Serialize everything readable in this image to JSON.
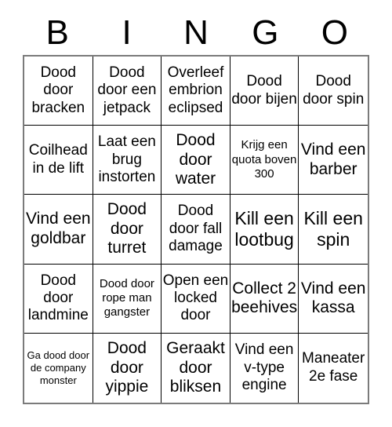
{
  "card": {
    "header_letters": [
      "B",
      "I",
      "N",
      "G",
      "O"
    ],
    "columns": 5,
    "rows": 5,
    "colors": {
      "background": "#ffffff",
      "text": "#000000",
      "cell_border": "#000000",
      "outer_border": "#7b7b7b"
    },
    "cells": [
      {
        "text": "Dood door bracken",
        "size": "md"
      },
      {
        "text": "Dood door een jetpack",
        "size": "md"
      },
      {
        "text": "Overleef embrion eclipsed",
        "size": "md"
      },
      {
        "text": "Dood door bijen",
        "size": "md"
      },
      {
        "text": "Dood door spin",
        "size": "md"
      },
      {
        "text": "Coilhead in de lift",
        "size": "md"
      },
      {
        "text": "Laat een brug instorten",
        "size": "md"
      },
      {
        "text": "Dood door water",
        "size": "lg"
      },
      {
        "text": "Krijg een quota boven 300",
        "size": "sm"
      },
      {
        "text": "Vind een barber",
        "size": "lg"
      },
      {
        "text": "Vind een goldbar",
        "size": "lg"
      },
      {
        "text": "Dood door turret",
        "size": "lg"
      },
      {
        "text": "Dood door fall damage",
        "size": "md"
      },
      {
        "text": "Kill een lootbug",
        "size": "xl"
      },
      {
        "text": "Kill een spin",
        "size": "xl"
      },
      {
        "text": "Dood door landmine",
        "size": "md"
      },
      {
        "text": "Dood door rope man gangster",
        "size": "sm"
      },
      {
        "text": "Open een locked door",
        "size": "md"
      },
      {
        "text": "Collect 2 beehives",
        "size": "lg"
      },
      {
        "text": "Vind een kassa",
        "size": "lg"
      },
      {
        "text": "Ga dood door de company monster",
        "size": "xs"
      },
      {
        "text": "Dood door yippie",
        "size": "lg"
      },
      {
        "text": "Geraakt door bliksen",
        "size": "lg"
      },
      {
        "text": "Vind een v-type engine",
        "size": "md"
      },
      {
        "text": "Maneater 2e fase",
        "size": "md"
      }
    ]
  }
}
